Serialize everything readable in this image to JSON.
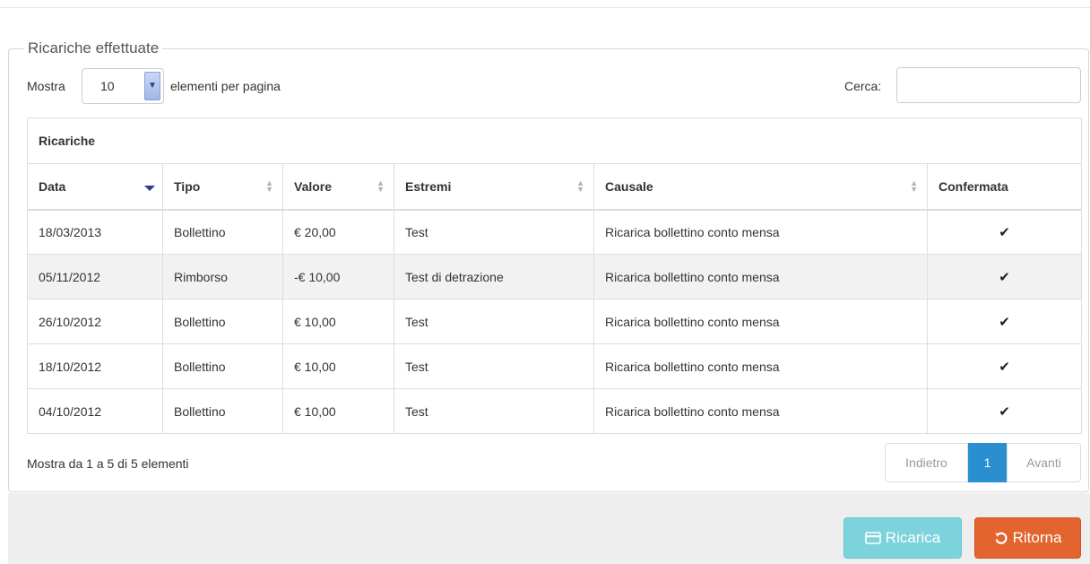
{
  "panel": {
    "legend": "Ricariche effettuate"
  },
  "length_control": {
    "prefix": "Mostra",
    "value": "10",
    "suffix": "elementi per pagina"
  },
  "search": {
    "label": "Cerca:",
    "value": ""
  },
  "table": {
    "caption": "Ricariche",
    "columns": [
      "Data",
      "Tipo",
      "Valore",
      "Estremi",
      "Causale",
      "Confermata"
    ],
    "sort": {
      "column": "Data",
      "direction": "desc"
    },
    "rows": [
      {
        "data": "18/03/2013",
        "tipo": "Bollettino",
        "valore": "€ 20,00",
        "estremi": "Test",
        "causale": "Ricarica bollettino conto mensa",
        "confermata": "✔"
      },
      {
        "data": "05/11/2012",
        "tipo": "Rimborso",
        "valore": "-€ 10,00",
        "estremi": "Test di detrazione",
        "causale": "Ricarica bollettino conto mensa",
        "confermata": "✔"
      },
      {
        "data": "26/10/2012",
        "tipo": "Bollettino",
        "valore": "€ 10,00",
        "estremi": "Test",
        "causale": "Ricarica bollettino conto mensa",
        "confermata": "✔"
      },
      {
        "data": "18/10/2012",
        "tipo": "Bollettino",
        "valore": "€ 10,00",
        "estremi": "Test",
        "causale": "Ricarica bollettino conto mensa",
        "confermata": "✔"
      },
      {
        "data": "04/10/2012",
        "tipo": "Bollettino",
        "valore": "€ 10,00",
        "estremi": "Test",
        "causale": "Ricarica bollettino conto mensa",
        "confermata": "✔"
      }
    ]
  },
  "info": "Mostra da 1 a 5 di 5 elementi",
  "pagination": {
    "prev": "Indietro",
    "current": "1",
    "next": "Avanti"
  },
  "buttons": {
    "ricarica": "Ricarica",
    "ritorna": "Ritorna"
  },
  "colors": {
    "primary_page": "#2a8fd0",
    "ricarica_button": "#7dd3db",
    "ritorna_button": "#e4642f",
    "striped_row": "#f2f2f2"
  }
}
